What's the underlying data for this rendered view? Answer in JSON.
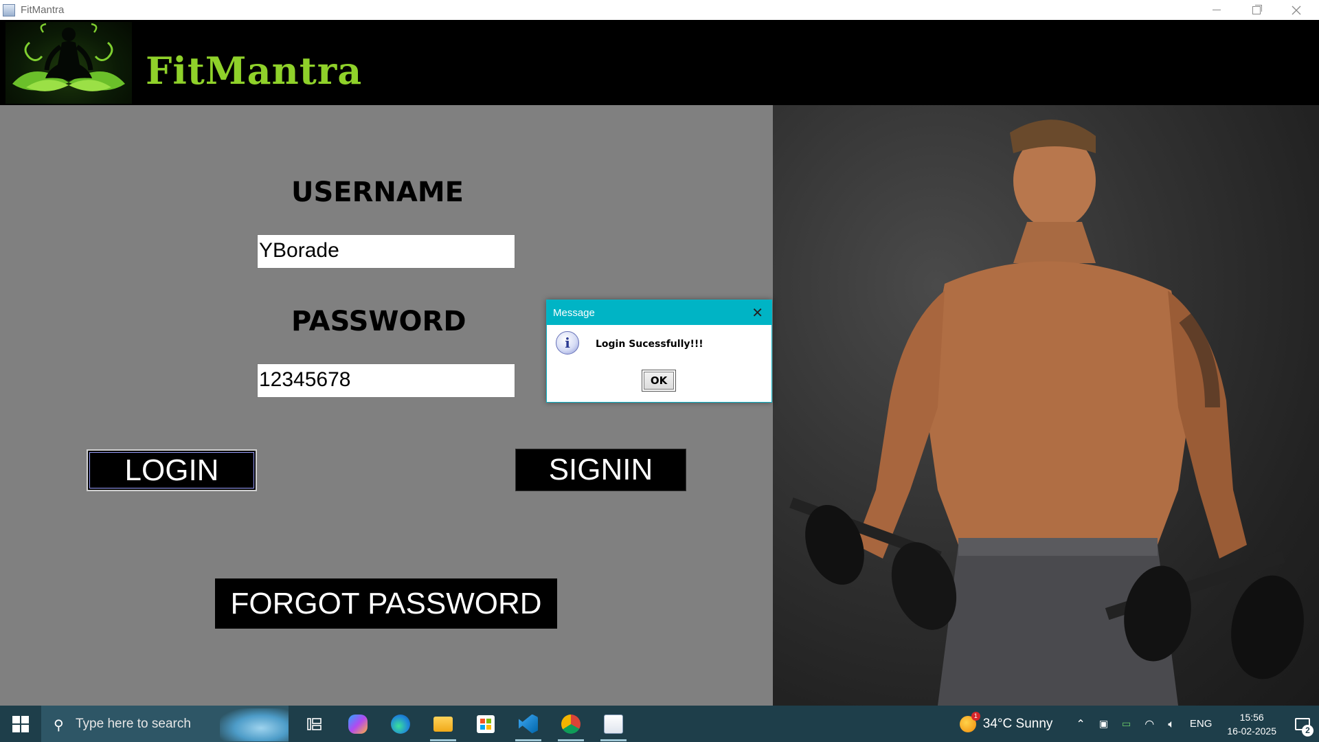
{
  "window": {
    "title": "FitMantra"
  },
  "header": {
    "brand": "FitMantra",
    "brand_color": "#8fd12a",
    "logo_icon": "yoga-meditation-logo-icon"
  },
  "login_form": {
    "username_label": "USERNAME",
    "username_value": "YBorade",
    "password_label": "PASSWORD",
    "password_value": "12345678",
    "login_button": "LOGIN",
    "signin_button": "SIGNIN",
    "forgot_button": "FORGOT PASSWORD"
  },
  "dialog": {
    "title": "Message",
    "message": "Login Sucessfully!!!",
    "ok_label": "OK",
    "accent_color": "#00b4c5",
    "icon": "information-icon"
  },
  "taskbar": {
    "search_placeholder": "Type here to search",
    "weather": "34°C  Sunny",
    "language": "ENG",
    "time": "15:56",
    "date": "16-02-2025",
    "notification_count": "2"
  }
}
